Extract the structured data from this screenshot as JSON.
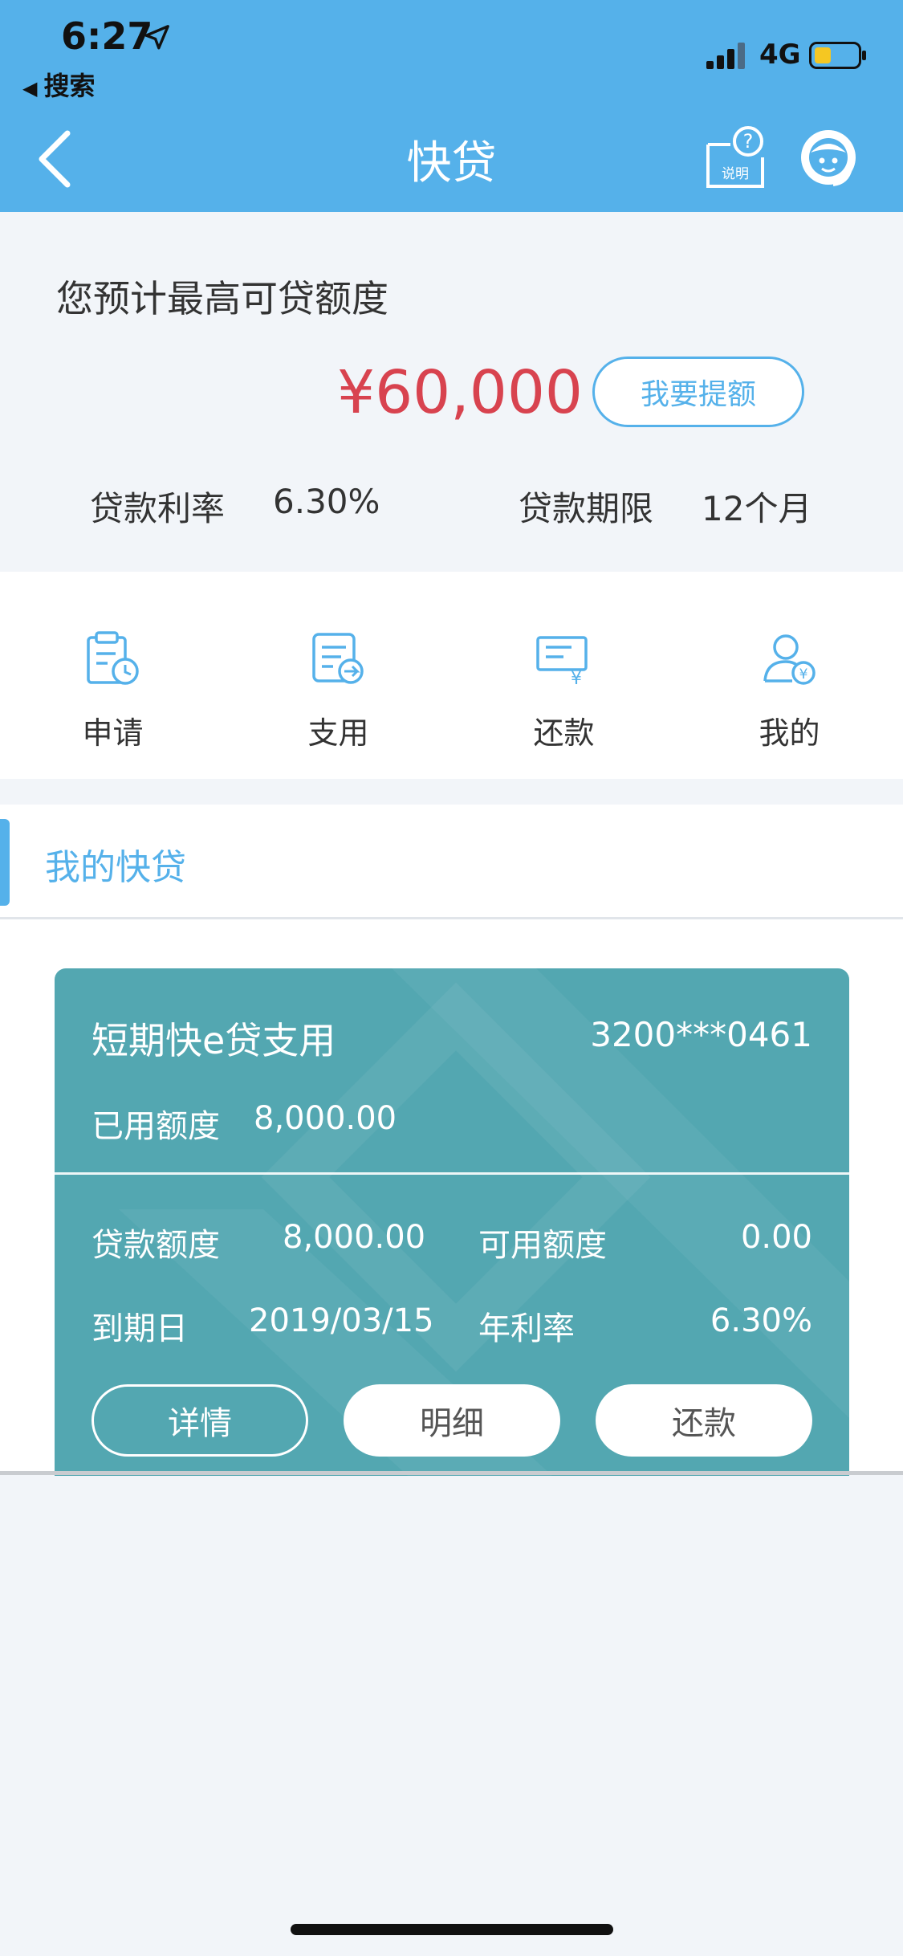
{
  "status_bar": {
    "time": "6:27",
    "back_app": "搜索",
    "network": "4G"
  },
  "nav": {
    "title": "快贷",
    "help_label": "说明"
  },
  "summary": {
    "label": "您预计最高可贷额度",
    "amount": "¥60,000",
    "raise_button": "我要提额",
    "rate_label": "贷款利率",
    "rate_value": "6.30%",
    "term_label": "贷款期限",
    "term_value": "12个月",
    "amount_color": "#d8434f"
  },
  "actions": [
    {
      "label": "申请",
      "icon": "application-clock-icon"
    },
    {
      "label": "支用",
      "icon": "withdraw-doc-icon"
    },
    {
      "label": "还款",
      "icon": "repay-yuan-icon"
    },
    {
      "label": "我的",
      "icon": "user-yuan-icon"
    }
  ],
  "my_loans": {
    "title": "我的快贷",
    "card": {
      "name": "短期快e贷支用",
      "account": "3200***0461",
      "used_label": "已用额度",
      "used_value": "8,000.00",
      "loan_amount_label": "贷款额度",
      "loan_amount_value": "8,000.00",
      "available_label": "可用额度",
      "available_value": "0.00",
      "due_label": "到期日",
      "due_value": "2019/03/15",
      "apr_label": "年利率",
      "apr_value": "6.30%",
      "buttons": {
        "detail": "详情",
        "items": "明细",
        "repay": "还款"
      }
    }
  },
  "colors": {
    "brand_blue": "#55b1ea",
    "card_teal": "#53a7b1",
    "page_bg": "#f2f5f9"
  }
}
